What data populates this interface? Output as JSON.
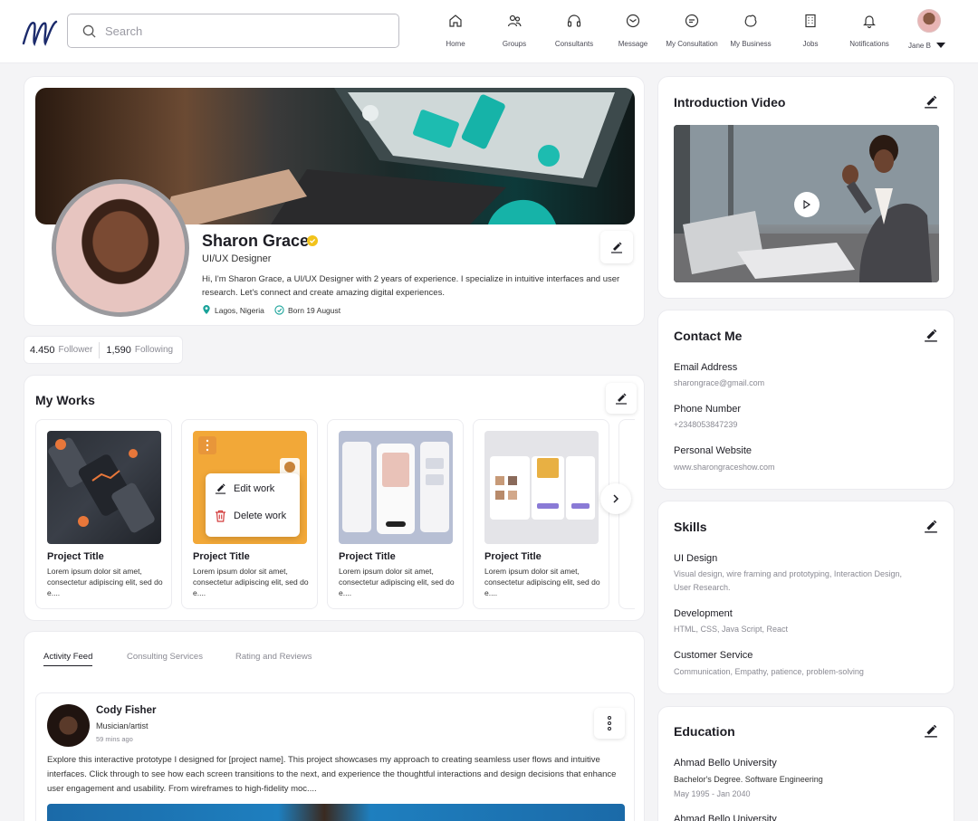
{
  "header": {
    "search_placeholder": "Search",
    "nav": [
      {
        "label": "Home",
        "icon": "home-icon"
      },
      {
        "label": "Groups",
        "icon": "groups-icon"
      },
      {
        "label": "Consultants",
        "icon": "headset-icon"
      },
      {
        "label": "Message",
        "icon": "message-icon"
      },
      {
        "label": "My Consultation",
        "icon": "consultation-icon"
      },
      {
        "label": "My Business",
        "icon": "business-icon"
      },
      {
        "label": "Jobs",
        "icon": "building-icon"
      },
      {
        "label": "Notifications",
        "icon": "bell-icon"
      }
    ],
    "user_name": "Jane B"
  },
  "profile": {
    "name": "Sharon Grace",
    "role": "UI/UX Designer",
    "bio": "Hi, I'm Sharon Grace, a UI/UX Designer with 2 years of experience. I specialize in intuitive interfaces and user research. Let's connect and create amazing digital experiences.",
    "location": "Lagos, Nigeria",
    "born": "Born 19  August",
    "followers_count": "4.450",
    "followers_label": "Follower",
    "following_count": "1,590",
    "following_label": "Following"
  },
  "works": {
    "title": "My Works",
    "menu": {
      "edit": "Edit work",
      "delete": "Delete work"
    },
    "items": [
      {
        "title": "Project Title",
        "desc": "Lorem ipsum dolor sit amet, consectetur adipiscing elit, sed do e...."
      },
      {
        "title": "Project Title",
        "desc": "Lorem ipsum dolor sit amet, consectetur adipiscing elit, sed do e...."
      },
      {
        "title": "Project Title",
        "desc": "Lorem ipsum dolor sit amet, consectetur adipiscing elit, sed do e...."
      },
      {
        "title": "Project Title",
        "desc": "Lorem ipsum dolor sit amet, consectetur adipiscing elit, sed do e...."
      }
    ]
  },
  "activity": {
    "tabs": [
      "Activity Feed",
      "Consulting Services",
      "Rating and Reviews"
    ],
    "post": {
      "author": "Cody Fisher",
      "role": "Musician/artist",
      "time": "59 mins ago",
      "text": "Explore this interactive prototype I designed for [project name]. This project showcases my approach to creating seamless user flows and intuitive interfaces. Click through to see how each screen transitions to the next, and experience the thoughtful interactions and design decisions that enhance user engagement and usability. From wireframes to high-fidelity moc...."
    }
  },
  "intro_video": {
    "title": "Introduction Video"
  },
  "contact": {
    "title": "Contact Me",
    "email_label": "Email Address",
    "email": "sharongrace@gmail.com",
    "phone_label": "Phone Number",
    "phone": "+2348053847239",
    "website_label": "Personal Website",
    "website": "www.sharongraceshow.com"
  },
  "skills": {
    "title": "Skills",
    "items": [
      {
        "name": "UI Design",
        "desc": "Visual design, wire framing and prototyping, Interaction Design, User Research."
      },
      {
        "name": "Development",
        "desc": "HTML, CSS, Java Script, React"
      },
      {
        "name": "Customer Service",
        "desc": "Communication, Empathy, patience, problem-solving"
      }
    ]
  },
  "education": {
    "title": "Education",
    "items": [
      {
        "school": "Ahmad Bello University",
        "degree": "Bachelor's Degree. Software Engineering",
        "period": "May 1995 - Jan 2040"
      },
      {
        "school": "Ahmad Bello University"
      }
    ]
  },
  "colors": {
    "accent": "#1d1d24",
    "verified": "#f2c31b",
    "location": "#1aa39a"
  }
}
